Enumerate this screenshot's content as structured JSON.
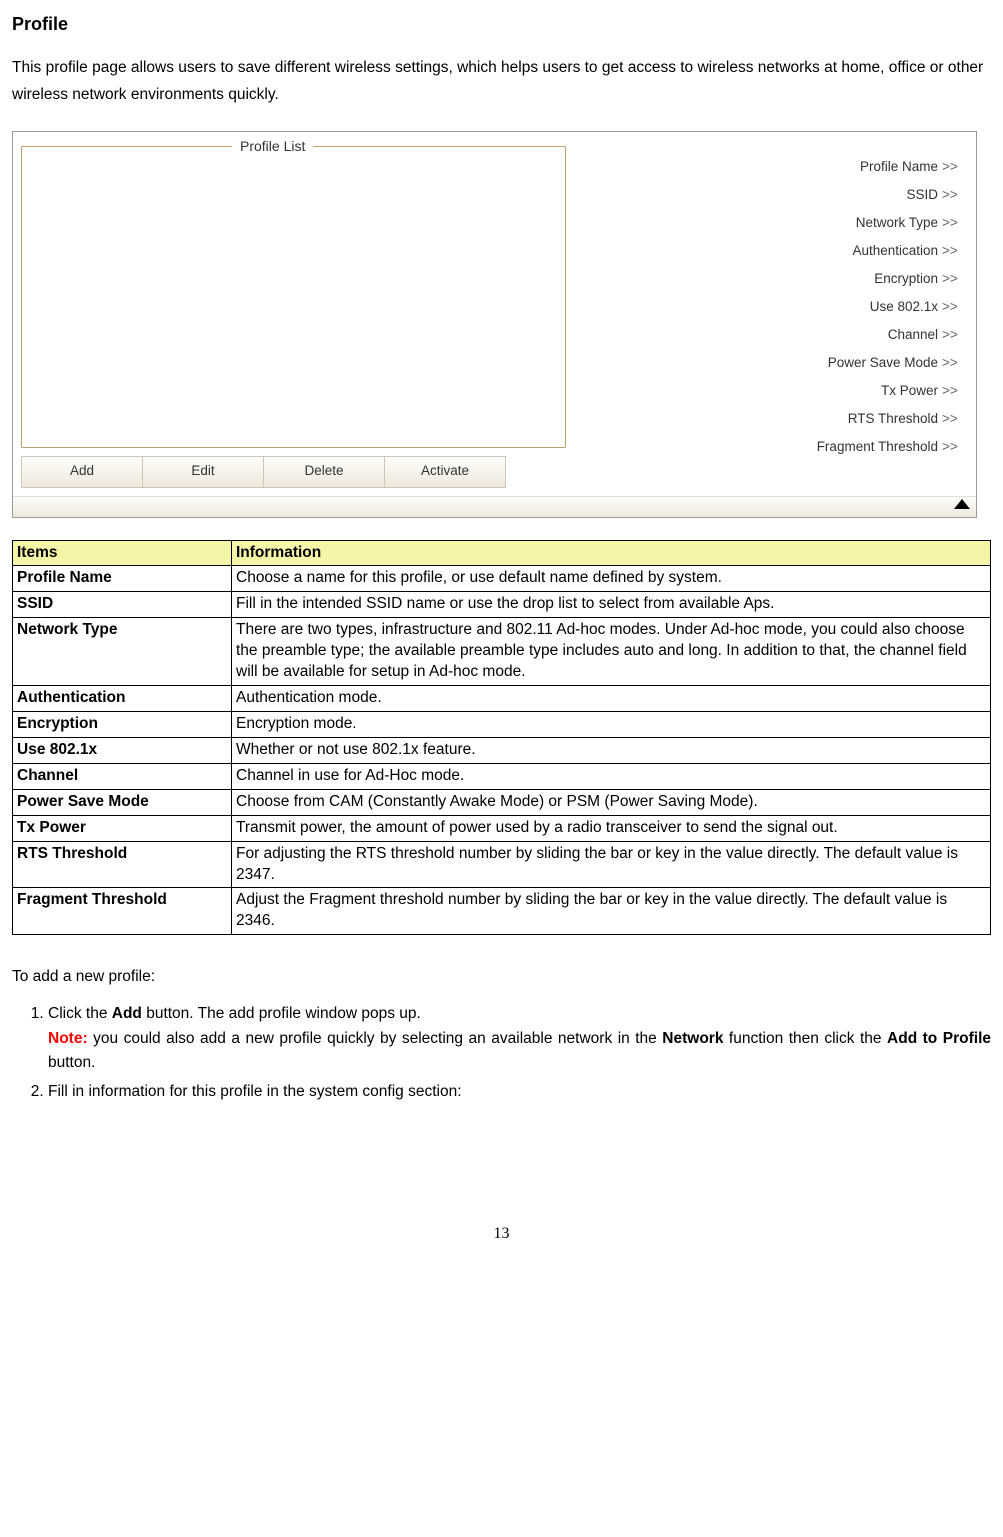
{
  "page": {
    "title": "Profile",
    "intro": "This profile page allows users to save different wireless settings, which helps users to get access to wireless networks at home, office or other wireless network environments quickly.",
    "number": "13"
  },
  "screenshot": {
    "legend": "Profile List",
    "buttons": [
      "Add",
      "Edit",
      "Delete",
      "Activate"
    ],
    "rows": [
      "Profile Name",
      "SSID",
      "Network Type",
      "Authentication",
      "Encryption",
      "Use 802.1x",
      "Channel",
      "Power Save Mode",
      "Tx Power",
      "RTS Threshold",
      "Fragment Threshold"
    ],
    "chev": ">>"
  },
  "table": {
    "headers": [
      "Items",
      "Information"
    ],
    "rows": [
      {
        "item": "Profile Name",
        "info": "Choose a name for this profile, or use default name defined by system."
      },
      {
        "item": "SSID",
        "info": "Fill in the intended SSID name or use the drop list to select from available Aps."
      },
      {
        "item": "Network Type",
        "info": "There are two types, infrastructure and 802.11 Ad-hoc modes. Under Ad-hoc mode, you could also choose the preamble type; the available preamble type includes auto and long. In addition to that, the channel field will be available for setup in Ad-hoc mode."
      },
      {
        "item": "Authentication",
        "info": "Authentication mode."
      },
      {
        "item": "Encryption",
        "info": "Encryption mode."
      },
      {
        "item": "Use 802.1x",
        "info": "Whether or not use 802.1x feature."
      },
      {
        "item": "Channel",
        "info": "Channel in use for Ad-Hoc mode."
      },
      {
        "item": "Power Save Mode",
        "info": "Choose from CAM (Constantly Awake Mode) or PSM (Power Saving Mode)."
      },
      {
        "item": "Tx Power",
        "info": "Transmit power, the amount of power used by a radio transceiver to send the signal out."
      },
      {
        "item": "RTS Threshold",
        "info": "For adjusting the RTS threshold number by sliding the bar or key in the value directly. The default value is 2347."
      },
      {
        "item": "Fragment Threshold",
        "info": "Adjust the Fragment threshold number by sliding the bar or key in the value directly. The default value is 2346."
      }
    ]
  },
  "instructions": {
    "lead": "To add a new profile:",
    "step1_a": "Click the ",
    "step1_b": "Add",
    "step1_c": " button. The add profile window pops up.",
    "note_label": "Note:",
    "note_a": " you could also add a new profile quickly by selecting an available network in the ",
    "note_b": "Network",
    "note_c": " function then click the ",
    "note_d": "Add to Profile",
    "note_e": " button.",
    "step2": "Fill in information for this profile in the system config section:"
  }
}
